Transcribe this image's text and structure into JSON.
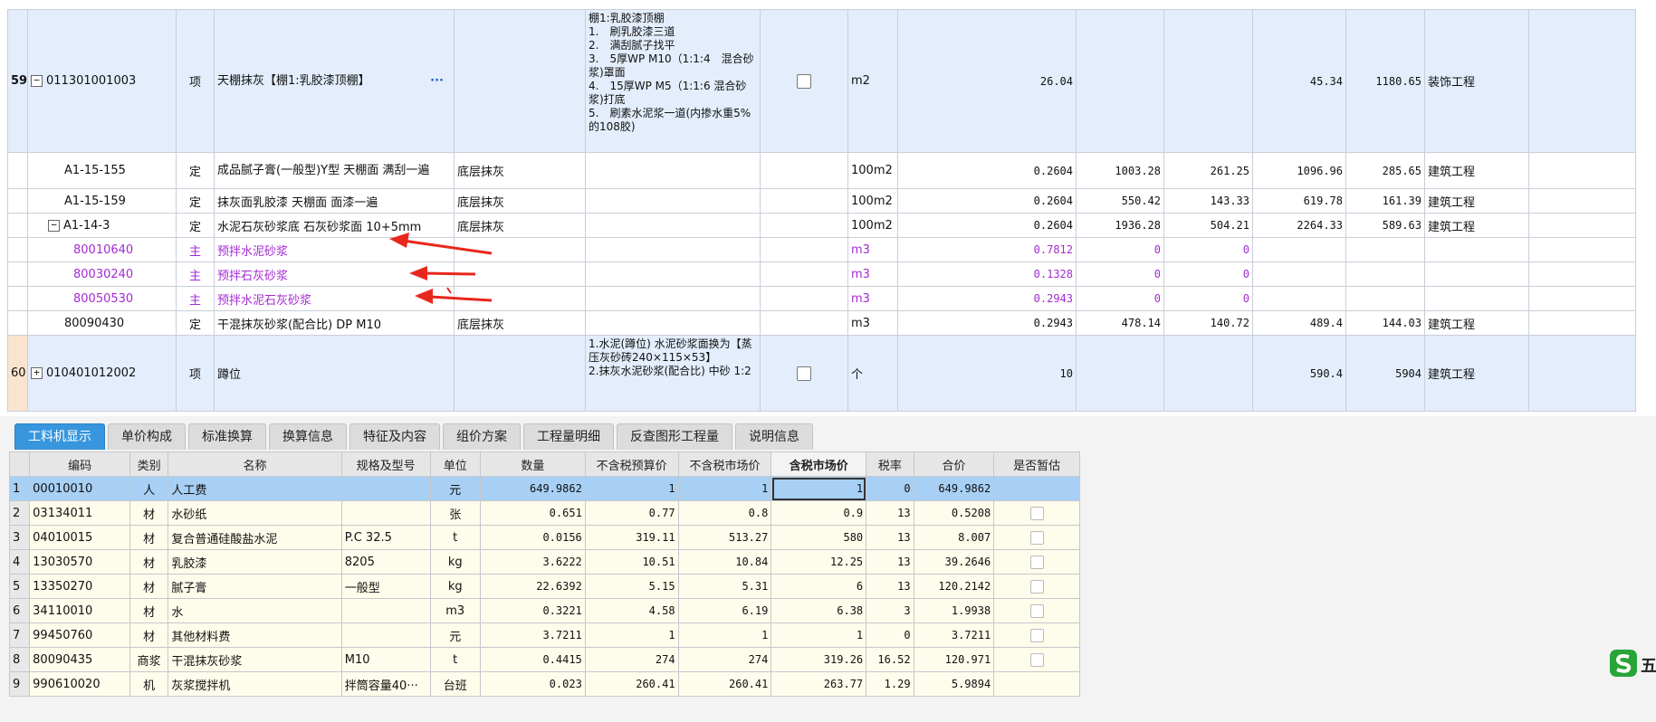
{
  "upper": {
    "r59": {
      "idx": "59",
      "code": "011301001003",
      "type": "项",
      "name": "天棚抹灰【棚1:乳胶漆顶棚】",
      "dots": "···",
      "desc": "棚1:乳胶漆顶棚\n1.　刷乳胶漆三道\n2.　满刮腻子找平\n3.　5厚WP M10（1:1:4　混合砂浆)罩面\n4.　15厚WP M5（1:1:6 混合砂浆)打底\n5.　刷素水泥浆一道(内掺水重5%的108胶)",
      "unit": "m2",
      "qty": "26.04",
      "p1": "",
      "p2": "",
      "p3": "45.34",
      "p4": "1180.65",
      "cat": "装饰工程"
    },
    "rows": [
      {
        "code": "A1-15-155",
        "type": "定",
        "name": "成品腻子膏(一般型)Y型 天棚面 满刮一遍",
        "spec": "底层抹灰",
        "unit": "100m2",
        "qty": "0.2604",
        "p1": "1003.28",
        "p2": "261.25",
        "p3": "1096.96",
        "p4": "285.65",
        "cat": "建筑工程"
      },
      {
        "code": "A1-15-159",
        "type": "定",
        "name": "抹灰面乳胶漆 天棚面 面漆一遍",
        "spec": "底层抹灰",
        "unit": "100m2",
        "qty": "0.2604",
        "p1": "550.42",
        "p2": "143.33",
        "p3": "619.78",
        "p4": "161.39",
        "cat": "建筑工程"
      },
      {
        "code": "A1-14-3",
        "type": "定",
        "name": "水泥石灰砂浆底 石灰砂浆面 10+5mm",
        "spec": "底层抹灰",
        "unit": "100m2",
        "qty": "0.2604",
        "p1": "1936.28",
        "p2": "504.21",
        "p3": "2264.33",
        "p4": "589.63",
        "cat": "建筑工程"
      },
      {
        "code": "80010640",
        "type": "主",
        "name": "预拌水泥砂浆",
        "spec": "",
        "unit": "m3",
        "qty": "0.7812",
        "p1": "0",
        "p2": "0",
        "p3": "",
        "p4": "",
        "cat": ""
      },
      {
        "code": "80030240",
        "type": "主",
        "name": "预拌石灰砂浆",
        "spec": "",
        "unit": "m3",
        "qty": "0.1328",
        "p1": "0",
        "p2": "0",
        "p3": "",
        "p4": "",
        "cat": ""
      },
      {
        "code": "80050530",
        "type": "主",
        "name": "预拌水泥石灰砂浆",
        "spec": "",
        "unit": "m3",
        "qty": "0.2943",
        "p1": "0",
        "p2": "0",
        "p3": "",
        "p4": "",
        "cat": ""
      },
      {
        "code": "80090430",
        "type": "定",
        "name": "干混抹灰砂浆(配合比) DP M10",
        "spec": "底层抹灰",
        "unit": "m3",
        "qty": "0.2943",
        "p1": "478.14",
        "p2": "140.72",
        "p3": "489.4",
        "p4": "144.03",
        "cat": "建筑工程"
      }
    ],
    "r60": {
      "idx": "60",
      "code": "010401012002",
      "type": "项",
      "name": "蹲位",
      "desc": "1.水泥(蹲位) 水泥砂浆面换为【蒸压灰砂砖240×115×53】\n2.抹灰水泥砂浆(配合比) 中砂 1:2",
      "unit": "个",
      "qty": "10",
      "p3": "590.4",
      "p4": "5904",
      "cat": "建筑工程"
    }
  },
  "tabs": [
    "工料机显示",
    "单价构成",
    "标准换算",
    "换算信息",
    "特征及内容",
    "组价方案",
    "工程量明细",
    "反查图形工程量",
    "说明信息"
  ],
  "lower": {
    "headers": [
      "编码",
      "类别",
      "名称",
      "规格及型号",
      "单位",
      "数量",
      "不含税预算价",
      "不含税市场价",
      "含税市场价",
      "税率",
      "合价",
      "是否暂估"
    ],
    "rows": [
      {
        "n": "1",
        "code": "00010010",
        "cls": "人",
        "name": "人工费",
        "spec": "",
        "unit": "元",
        "qty": "649.9862",
        "p1": "1",
        "p2": "1",
        "p3": "1",
        "tax": "0",
        "total": "649.9862",
        "cb": false
      },
      {
        "n": "2",
        "code": "03134011",
        "cls": "材",
        "name": "水砂纸",
        "spec": "",
        "unit": "张",
        "qty": "0.651",
        "p1": "0.77",
        "p2": "0.8",
        "p3": "0.9",
        "tax": "13",
        "total": "0.5208",
        "cb": true
      },
      {
        "n": "3",
        "code": "04010015",
        "cls": "材",
        "name": "复合普通硅酸盐水泥",
        "spec": "P.C 32.5",
        "unit": "t",
        "qty": "0.0156",
        "p1": "319.11",
        "p2": "513.27",
        "p3": "580",
        "tax": "13",
        "total": "8.007",
        "cb": true
      },
      {
        "n": "4",
        "code": "13030570",
        "cls": "材",
        "name": "乳胶漆",
        "spec": "8205",
        "unit": "kg",
        "qty": "3.6222",
        "p1": "10.51",
        "p2": "10.84",
        "p3": "12.25",
        "tax": "13",
        "total": "39.2646",
        "cb": true
      },
      {
        "n": "5",
        "code": "13350270",
        "cls": "材",
        "name": "腻子膏",
        "spec": "一般型",
        "unit": "kg",
        "qty": "22.6392",
        "p1": "5.15",
        "p2": "5.31",
        "p3": "6",
        "tax": "13",
        "total": "120.2142",
        "cb": true
      },
      {
        "n": "6",
        "code": "34110010",
        "cls": "材",
        "name": "水",
        "spec": "",
        "unit": "m3",
        "qty": "0.3221",
        "p1": "4.58",
        "p2": "6.19",
        "p3": "6.38",
        "tax": "3",
        "total": "1.9938",
        "cb": true
      },
      {
        "n": "7",
        "code": "99450760",
        "cls": "材",
        "name": "其他材料费",
        "spec": "",
        "unit": "元",
        "qty": "3.7211",
        "p1": "1",
        "p2": "1",
        "p3": "1",
        "tax": "0",
        "total": "3.7211",
        "cb": true
      },
      {
        "n": "8",
        "code": "80090435",
        "cls": "商浆",
        "name": "干混抹灰砂浆",
        "spec": "M10",
        "unit": "t",
        "qty": "0.4415",
        "p1": "274",
        "p2": "274",
        "p3": "319.26",
        "tax": "16.52",
        "total": "120.971",
        "cb": true
      },
      {
        "n": "9",
        "code": "990610020",
        "cls": "机",
        "name": "灰浆搅拌机",
        "spec": "拌筒容量40···",
        "unit": "台班",
        "qty": "0.023",
        "p1": "260.41",
        "p2": "260.41",
        "p3": "263.77",
        "tax": "1.29",
        "total": "5.9894",
        "cb": false
      }
    ]
  },
  "logo_text": "五",
  "colors": {
    "accent": "#3796dd",
    "highlight_row": "#a8d0f5",
    "material_text": "#a42bd1",
    "arrow": "#e8271c"
  }
}
